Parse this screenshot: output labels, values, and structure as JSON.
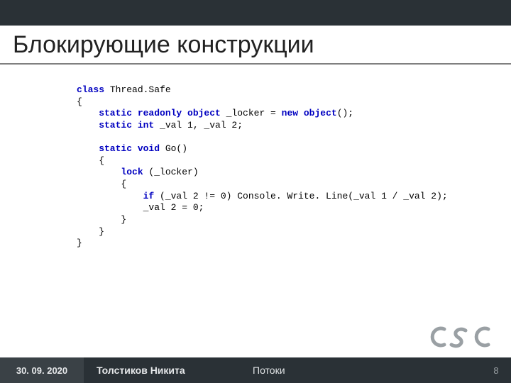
{
  "title": "Блокирующие конструкции",
  "code": {
    "l00a": "class",
    "l00b": " Thread.Safe",
    "l01": "{",
    "l02a": "    static readonly object",
    "l02b": " _locker = ",
    "l02c": "new object",
    "l02d": "();",
    "l03a": "    static int",
    "l03b": " _val 1, _val 2;",
    "l04": "",
    "l05a": "    static void",
    "l05b": " Go()",
    "l06": "    {",
    "l07a": "        lock",
    "l07b": " (_locker)",
    "l08": "        {",
    "l09a": "            if",
    "l09b": " (_val 2 != 0) Console. Write. Line(_val 1 / _val 2);",
    "l10": "            _val 2 = 0;",
    "l11": "        }",
    "l12": "    }",
    "l13": "}"
  },
  "footer": {
    "date": "30. 09. 2020",
    "author": "Толстиков Никита",
    "topic": "Потоки",
    "page": "8"
  },
  "logo_text": "CSC"
}
